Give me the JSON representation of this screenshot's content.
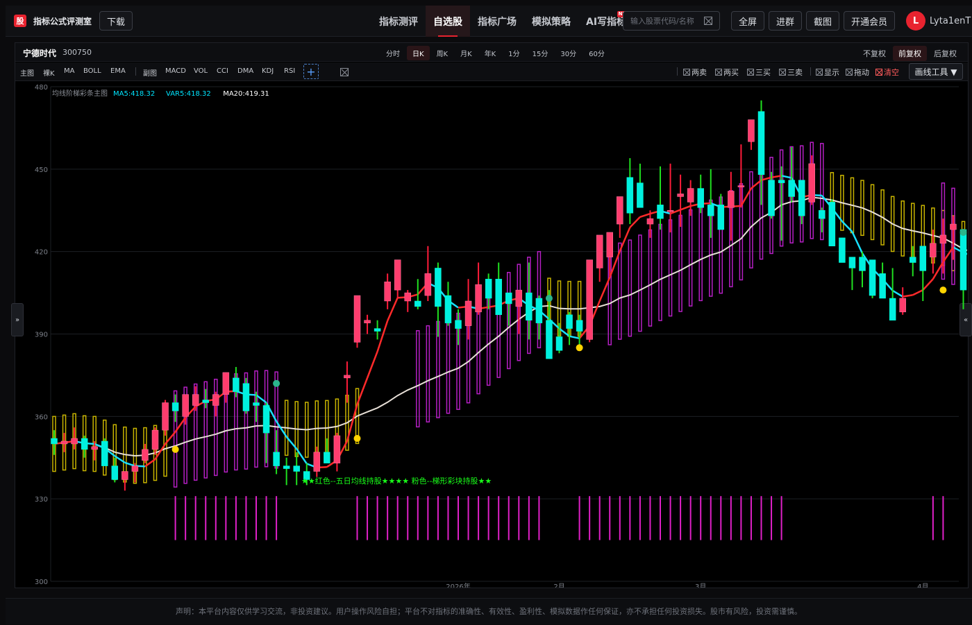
{
  "app": {
    "logo_char": "股",
    "name": "指标公式评测室",
    "download": "下载"
  },
  "nav": [
    {
      "label": "指标测评"
    },
    {
      "label": "自选股",
      "active": true
    },
    {
      "label": "指标广场"
    },
    {
      "label": "模拟策略"
    },
    {
      "label": "AI写指标",
      "badge": "NEW"
    }
  ],
  "search": {
    "placeholder": "输入股票代码/名称"
  },
  "toolbar": {
    "fullscreen": "全屏",
    "queue": "进群",
    "screenshot": "截图",
    "vip": "开通会员"
  },
  "user": {
    "initial": "L",
    "name": "Lyta1enT"
  },
  "stock": {
    "name": "宁德时代",
    "code": "300750"
  },
  "periods": [
    "分时",
    "日K",
    "周K",
    "月K",
    "年K",
    "1分",
    "15分",
    "30分",
    "60分"
  ],
  "active_period": "日K",
  "adjust": [
    "不复权",
    "前复权",
    "后复权"
  ],
  "active_adjust": "前复权",
  "indicators": {
    "main_label": "主图",
    "main": [
      "裸K",
      "MA",
      "BOLL",
      "EMA"
    ],
    "sub_label": "副图",
    "sub": [
      "MACD",
      "VOL",
      "CCI",
      "DMA",
      "KDJ",
      "RSI"
    ]
  },
  "tools": [
    {
      "label": "两卖"
    },
    {
      "label": "两买"
    },
    {
      "label": "三买"
    },
    {
      "label": "三卖"
    },
    {
      "label": "显示"
    },
    {
      "label": "拖动"
    },
    {
      "label": "清空",
      "red": true
    }
  ],
  "draw_tool": "画线工具 ▼",
  "side": {
    "left": "»",
    "right": "«"
  },
  "chart_data": {
    "type": "candlestick",
    "title": "均线阶梯彩条主图",
    "legend": [
      {
        "label": "MA5:418.32",
        "color": "#00e5ff"
      },
      {
        "label": "VAR5:418.32",
        "color": "#00e5ff"
      },
      {
        "label": "MA20:419.31",
        "color": "#ffffff"
      }
    ],
    "y_ticks": [
      480,
      450,
      420,
      390,
      360,
      330,
      300
    ],
    "ylim": [
      300,
      480
    ],
    "x_ticks": [
      {
        "label": "2026年",
        "i": 40
      },
      {
        "label": "2月",
        "i": 50
      },
      {
        "label": "3月",
        "i": 64
      },
      {
        "label": "4月",
        "i": 86
      }
    ],
    "annotation": "★★红色--五日均线持股★★★★ 粉色--梯形彩块持股★★",
    "ohlc": [
      [
        352,
        355,
        346,
        350
      ],
      [
        350,
        354,
        347,
        351
      ],
      [
        350,
        356,
        348,
        352
      ],
      [
        352,
        353,
        345,
        348
      ],
      [
        348,
        351,
        344,
        349
      ],
      [
        351,
        352,
        343,
        342
      ],
      [
        342,
        345,
        336,
        337
      ],
      [
        337,
        340,
        333,
        340
      ],
      [
        340,
        343,
        336,
        342
      ],
      [
        344,
        350,
        343,
        348
      ],
      [
        348,
        356,
        346,
        355
      ],
      [
        355,
        366,
        353,
        365
      ],
      [
        365,
        368,
        358,
        362
      ],
      [
        360,
        367,
        357,
        368
      ],
      [
        364,
        371,
        362,
        368
      ],
      [
        366,
        370,
        363,
        365
      ],
      [
        364,
        369,
        360,
        368
      ],
      [
        368,
        376,
        365,
        376
      ],
      [
        374,
        378,
        367,
        369
      ],
      [
        372,
        374,
        361,
        362
      ],
      [
        365,
        369,
        358,
        364
      ],
      [
        364,
        365,
        343,
        354
      ],
      [
        347,
        355,
        339,
        342
      ],
      [
        342,
        345,
        335,
        341
      ],
      [
        342,
        347,
        335,
        340
      ],
      [
        340,
        343,
        335,
        337
      ],
      [
        340,
        349,
        338,
        347
      ],
      [
        347,
        352,
        345,
        343
      ],
      [
        343,
        354,
        340,
        353
      ],
      [
        374,
        380,
        365,
        375
      ],
      [
        387,
        402,
        385,
        404
      ],
      [
        394,
        397,
        390,
        395
      ],
      [
        392,
        395,
        388,
        391
      ],
      [
        402,
        412,
        399,
        409
      ],
      [
        406,
        417,
        403,
        417
      ],
      [
        402,
        406,
        398,
        405
      ],
      [
        402,
        410,
        399,
        400
      ],
      [
        404,
        422,
        402,
        412
      ],
      [
        414,
        416,
        389,
        400
      ],
      [
        404,
        409,
        393,
        394
      ],
      [
        395,
        399,
        386,
        392
      ],
      [
        393,
        410,
        388,
        402
      ],
      [
        398,
        416,
        397,
        408
      ],
      [
        410,
        412,
        399,
        403
      ],
      [
        410,
        416,
        398,
        397
      ],
      [
        405,
        405,
        393,
        401
      ],
      [
        400,
        405,
        390,
        406
      ],
      [
        405,
        416,
        388,
        395
      ],
      [
        403,
        404,
        388,
        394
      ],
      [
        395,
        406,
        381,
        381
      ],
      [
        389,
        394,
        383,
        384
      ],
      [
        397,
        398,
        386,
        392
      ],
      [
        395,
        397,
        385,
        391
      ],
      [
        388,
        414,
        387,
        417
      ],
      [
        414,
        421,
        409,
        426
      ],
      [
        418,
        424,
        411,
        427
      ],
      [
        430,
        435,
        425,
        440
      ],
      [
        447,
        454,
        430,
        434
      ],
      [
        445,
        452,
        439,
        436
      ],
      [
        430,
        435,
        425,
        432
      ],
      [
        437,
        451,
        428,
        432
      ],
      [
        435,
        452,
        427,
        435
      ],
      [
        440,
        448,
        429,
        441
      ],
      [
        438,
        446,
        433,
        443
      ],
      [
        443,
        448,
        434,
        436
      ],
      [
        437,
        450,
        425,
        433
      ],
      [
        437,
        441,
        431,
        428
      ],
      [
        436,
        449,
        424,
        442
      ],
      [
        444,
        459,
        436,
        444
      ],
      [
        460,
        467,
        457,
        468
      ],
      [
        471,
        475,
        437,
        448
      ],
      [
        446,
        449,
        432,
        433
      ],
      [
        446,
        451,
        424,
        445
      ],
      [
        446,
        458,
        438,
        440
      ],
      [
        446,
        443,
        430,
        433
      ],
      [
        438,
        455,
        437,
        452
      ],
      [
        435,
        436,
        427,
        432
      ],
      [
        438,
        439,
        424,
        422
      ],
      [
        425,
        425,
        416,
        416
      ],
      [
        418,
        418,
        406,
        414
      ],
      [
        418,
        420,
        407,
        413
      ],
      [
        417,
        414,
        403,
        404
      ],
      [
        412,
        416,
        403,
        403
      ],
      [
        403,
        414,
        398,
        395
      ],
      [
        398,
        407,
        397,
        403
      ],
      [
        418,
        422,
        411,
        416
      ],
      [
        422,
        420,
        402,
        413
      ],
      [
        418,
        428,
        412,
        423
      ],
      [
        423,
        432,
        412,
        426
      ],
      [
        428,
        433,
        417,
        430
      ],
      [
        428,
        419,
        399,
        406
      ],
      [
        409,
        408,
        405,
        407
      ]
    ],
    "ribbon_yellow_x": [
      0,
      1,
      2,
      3,
      4,
      5,
      6,
      7,
      8,
      9,
      10,
      11,
      23,
      24,
      25,
      26,
      27,
      28,
      29,
      30,
      49,
      50,
      51,
      52,
      53,
      77,
      78,
      79,
      80,
      81,
      82,
      83,
      84,
      85,
      86,
      87,
      88,
      89,
      90,
      91,
      92
    ],
    "ribbon_magenta_x": [
      12,
      13,
      14,
      15,
      16,
      17,
      18,
      19,
      20,
      21,
      22,
      36,
      37,
      38,
      39,
      40,
      41,
      42,
      43,
      44,
      45,
      46,
      47,
      48,
      55,
      56,
      57,
      58,
      59,
      60,
      61,
      62,
      63,
      64,
      65,
      66,
      67,
      68,
      69,
      70,
      71,
      72,
      73,
      74,
      75,
      76,
      88,
      89
    ],
    "dots": [
      {
        "i": 12,
        "y": 348,
        "c": "#ffd400"
      },
      {
        "i": 22,
        "y": 372,
        "c": "#2ab58b"
      },
      {
        "i": 30,
        "y": 352,
        "c": "#ffd400"
      },
      {
        "i": 49,
        "y": 403,
        "c": "#2ab58b"
      },
      {
        "i": 52,
        "y": 385,
        "c": "#ffd400"
      },
      {
        "i": 88,
        "y": 406,
        "c": "#ffd400"
      },
      {
        "i": 90,
        "y": 427,
        "c": "#2ab58b"
      }
    ]
  },
  "footer": "声明：本平台内容仅供学习交流，非投资建议。用户操作风险自担；平台不对指标的准确性、有效性、盈利性、模拟数据作任何保证，亦不承担任何投资损失。股市有风险，投资需谨慎。"
}
